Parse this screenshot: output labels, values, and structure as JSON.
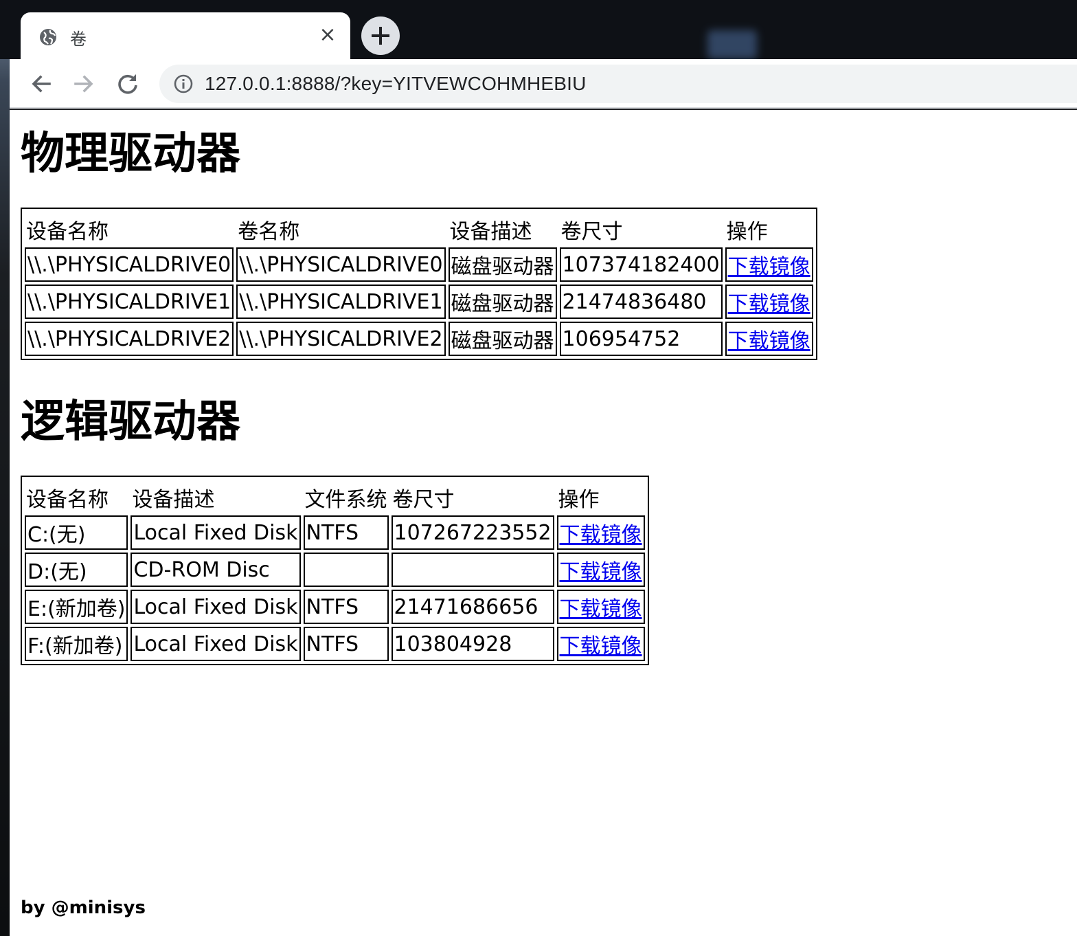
{
  "browser": {
    "tab_title": "卷",
    "close_symbol": "×",
    "url": "127.0.0.1:8888/?key=YITVEWCOHMHEBIU"
  },
  "physical": {
    "heading": "物理驱动器",
    "headers": [
      "设备名称",
      "卷名称",
      "设备描述",
      "卷尺寸",
      "操作"
    ],
    "rows": [
      [
        "\\\\.\\PHYSICALDRIVE0",
        "\\\\.\\PHYSICALDRIVE0",
        "磁盘驱动器",
        "107374182400",
        "下载镜像"
      ],
      [
        "\\\\.\\PHYSICALDRIVE1",
        "\\\\.\\PHYSICALDRIVE1",
        "磁盘驱动器",
        "21474836480",
        "下载镜像"
      ],
      [
        "\\\\.\\PHYSICALDRIVE2",
        "\\\\.\\PHYSICALDRIVE2",
        "磁盘驱动器",
        "106954752",
        "下载镜像"
      ]
    ]
  },
  "logical": {
    "heading": "逻辑驱动器",
    "headers": [
      "设备名称",
      "设备描述",
      "文件系统",
      "卷尺寸",
      "操作"
    ],
    "rows": [
      [
        "C:(无)",
        "Local Fixed Disk",
        "NTFS",
        "107267223552",
        "下载镜像"
      ],
      [
        "D:(无)",
        "CD-ROM Disc",
        "",
        "",
        "下载镜像"
      ],
      [
        "E:(新加卷)",
        "Local Fixed Disk",
        "NTFS",
        "21471686656",
        "下载镜像"
      ],
      [
        "F:(新加卷)",
        "Local Fixed Disk",
        "NTFS",
        "103804928",
        "下载镜像"
      ]
    ]
  },
  "footer": "by @minisys",
  "icons": {
    "tab_favicon": "globe-icon",
    "back": "back-arrow-icon",
    "forward": "forward-arrow-icon",
    "reload": "reload-icon",
    "site_info": "info-icon",
    "new_tab": "plus-icon"
  },
  "colors": {
    "link": "#0000ee",
    "tabbar": "#0e1116",
    "omnibox": "#f1f3f4"
  }
}
